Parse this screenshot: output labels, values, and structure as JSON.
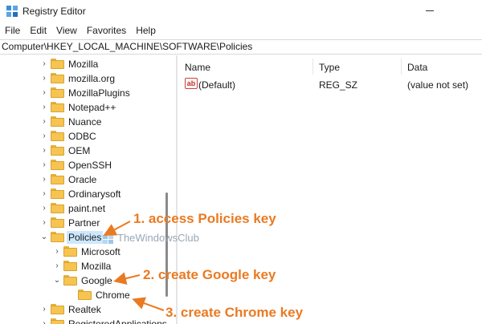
{
  "window": {
    "title": "Registry Editor"
  },
  "menu": {
    "items": [
      "File",
      "Edit",
      "View",
      "Favorites",
      "Help"
    ]
  },
  "address": {
    "path": "Computer\\HKEY_LOCAL_MACHINE\\SOFTWARE\\Policies"
  },
  "tree": {
    "items": [
      {
        "label": "Mozilla",
        "expanded": false,
        "selected": false
      },
      {
        "label": "mozilla.org",
        "expanded": false,
        "selected": false
      },
      {
        "label": "MozillaPlugins",
        "expanded": false,
        "selected": false
      },
      {
        "label": "Notepad++",
        "expanded": false,
        "selected": false
      },
      {
        "label": "Nuance",
        "expanded": false,
        "selected": false
      },
      {
        "label": "ODBC",
        "expanded": false,
        "selected": false
      },
      {
        "label": "OEM",
        "expanded": false,
        "selected": false
      },
      {
        "label": "OpenSSH",
        "expanded": false,
        "selected": false
      },
      {
        "label": "Oracle",
        "expanded": false,
        "selected": false
      },
      {
        "label": "Ordinarysoft",
        "expanded": false,
        "selected": false
      },
      {
        "label": "paint.net",
        "expanded": false,
        "selected": false
      },
      {
        "label": "Partner",
        "expanded": false,
        "selected": false
      },
      {
        "label": "Policies",
        "expanded": true,
        "selected": true
      },
      {
        "label": "Microsoft",
        "expanded": false,
        "selected": false
      },
      {
        "label": "Mozilla",
        "expanded": false,
        "selected": false
      },
      {
        "label": "Google",
        "expanded": true,
        "selected": false
      },
      {
        "label": "Chrome",
        "expanded": false,
        "selected": false
      },
      {
        "label": "Realtek",
        "expanded": false,
        "selected": false
      },
      {
        "label": "RegisteredApplications",
        "expanded": false,
        "selected": false
      }
    ]
  },
  "list": {
    "headers": {
      "name": "Name",
      "type": "Type",
      "data": "Data"
    },
    "rows": [
      {
        "icon": "ab",
        "name": "(Default)",
        "type": "REG_SZ",
        "data": "(value not set)"
      }
    ]
  },
  "watermark": {
    "text": "TheWindowsClub"
  },
  "annotations": {
    "step1": "1. access Policies key",
    "step2": "2. create Google key",
    "step3": "3. create Chrome key",
    "color": "#ea7a22"
  },
  "colors": {
    "selection": "#cce8ff",
    "folder": "#f6c450"
  }
}
